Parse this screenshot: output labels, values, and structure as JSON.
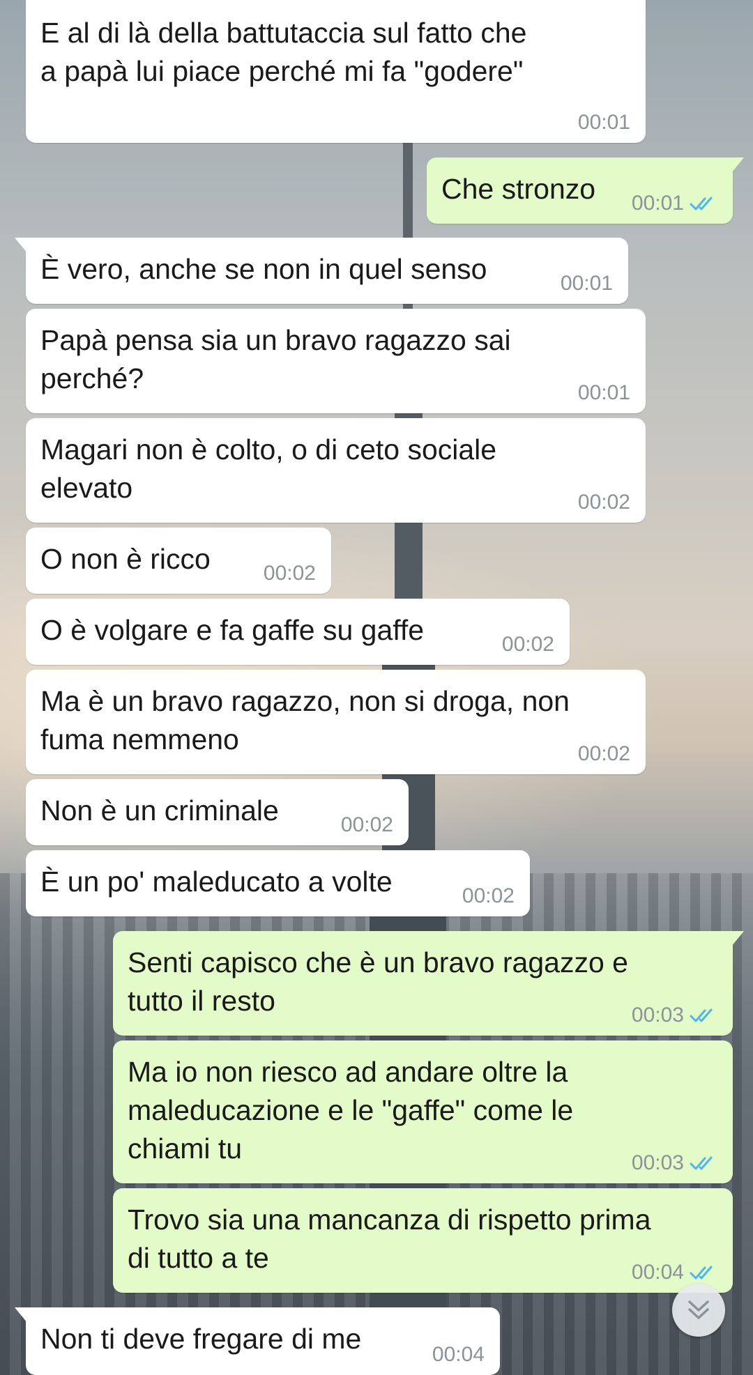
{
  "messages": [
    {
      "direction": "in",
      "text": "E al di là della battutaccia sul fatto che\na papà lui piace perché mi fa \"godere\"",
      "time": "00:01"
    },
    {
      "direction": "out",
      "text": "Che stronzo",
      "time": "00:01",
      "status": "read"
    },
    {
      "direction": "in",
      "text": "È vero, anche se non in quel senso",
      "time": "00:01"
    },
    {
      "direction": "in",
      "text": "Papà pensa sia un bravo ragazzo sai\nperché?",
      "time": "00:01"
    },
    {
      "direction": "in",
      "text": "Magari non è colto, o di ceto sociale\nelevato",
      "time": "00:02"
    },
    {
      "direction": "in",
      "text": "O non è ricco",
      "time": "00:02"
    },
    {
      "direction": "in",
      "text": "O è volgare e fa gaffe su gaffe",
      "time": "00:02"
    },
    {
      "direction": "in",
      "text": "Ma è un bravo ragazzo, non si droga, non\nfuma nemmeno",
      "time": "00:02"
    },
    {
      "direction": "in",
      "text": "Non è un criminale",
      "time": "00:02"
    },
    {
      "direction": "in",
      "text": "È un po' maleducato a volte",
      "time": "00:02"
    },
    {
      "direction": "out",
      "text": "Senti capisco che è un bravo ragazzo e\ntutto il resto",
      "time": "00:03",
      "status": "read"
    },
    {
      "direction": "out",
      "text": "Ma io non riesco ad andare oltre la\nmaleducazione e le \"gaffe\" come le\nchiami tu",
      "time": "00:03",
      "status": "read"
    },
    {
      "direction": "out",
      "text": "Trovo sia una mancanza di rispetto prima\ndi tutto a te",
      "time": "00:04",
      "status": "read"
    },
    {
      "direction": "in",
      "text": "Non ti deve fregare di me",
      "time": "00:04"
    }
  ],
  "scroll_button": {
    "icon": "double-chevron-down-icon"
  },
  "colors": {
    "incoming_bubble": "#ffffff",
    "outgoing_bubble": "#e2fbc8",
    "read_check": "#4fb6ec",
    "timestamp": "#8c9299"
  }
}
